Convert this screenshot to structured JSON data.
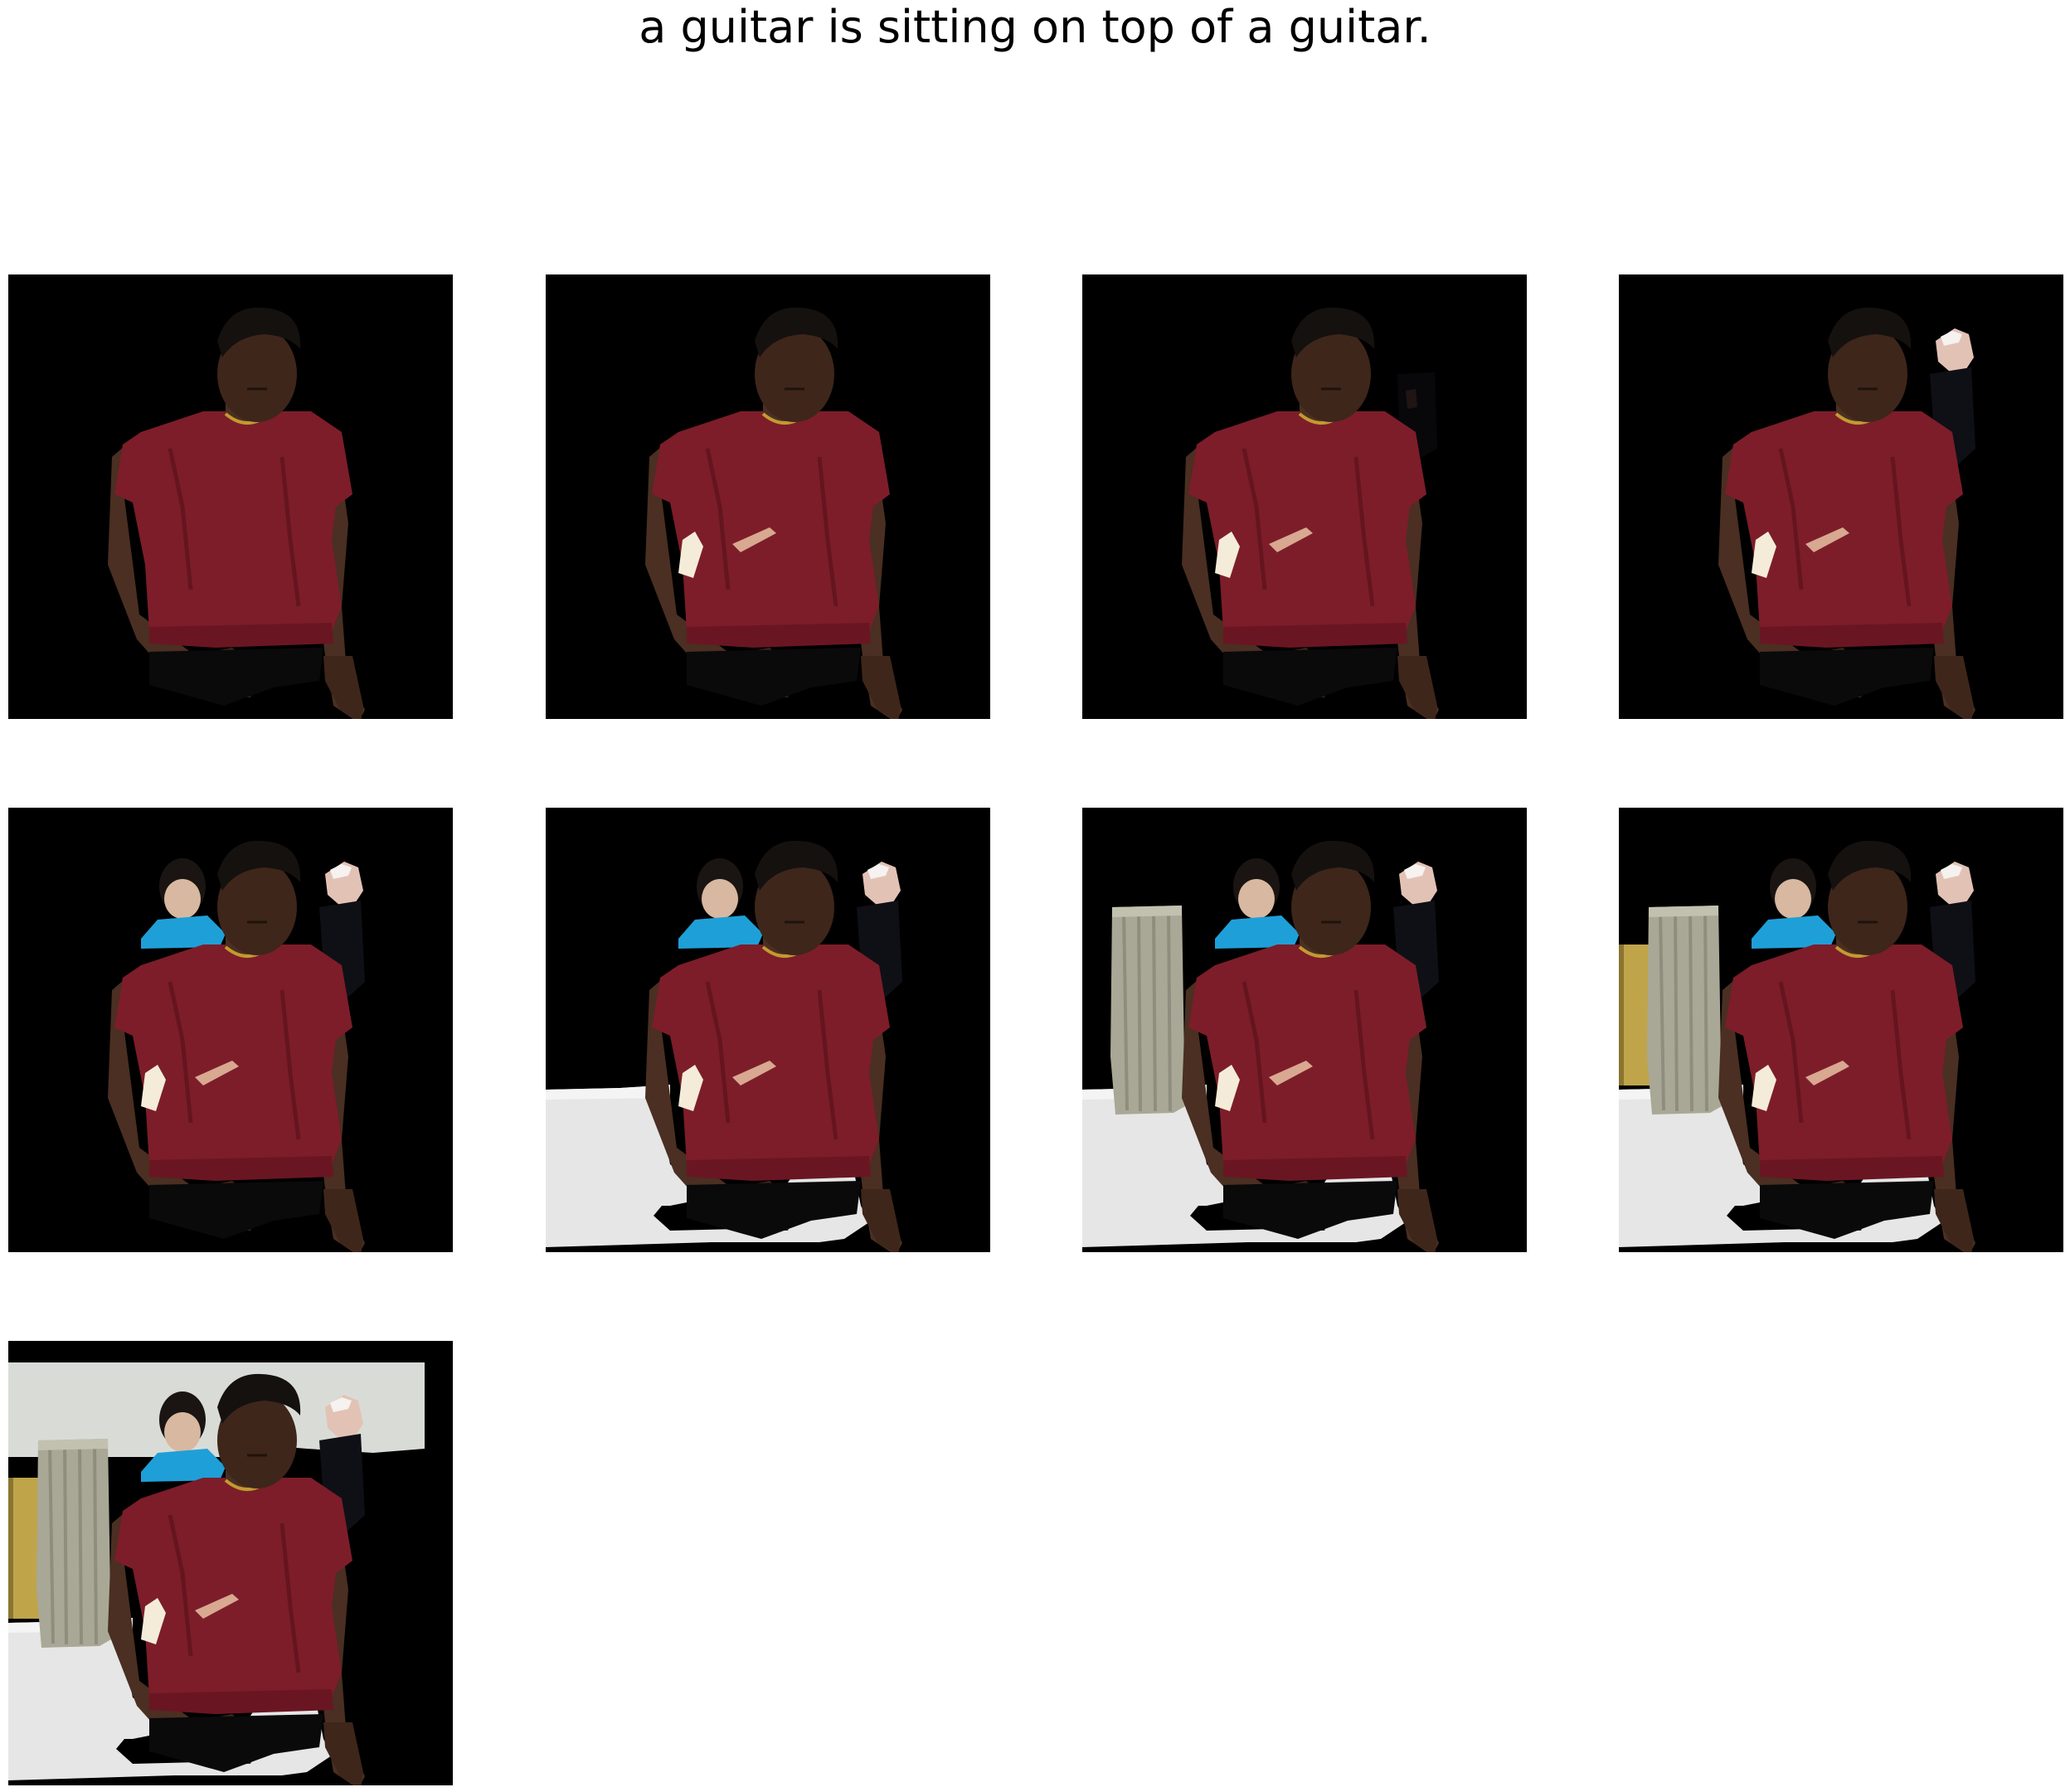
{
  "caption": "a guitar is sitting on top of a guitar.",
  "panels": [
    {
      "index": 1,
      "layers": [
        "person"
      ]
    },
    {
      "index": 2,
      "layers": [
        "person",
        "hand-object"
      ]
    },
    {
      "index": 3,
      "layers": [
        "person",
        "hand-object",
        "dark-object"
      ]
    },
    {
      "index": 4,
      "layers": [
        "person",
        "hand-object",
        "dark-object",
        "background-head"
      ]
    },
    {
      "index": 5,
      "layers": [
        "person",
        "hand-object",
        "dark-object",
        "background-head",
        "blue-shirt-person"
      ]
    },
    {
      "index": 6,
      "layers": [
        "person",
        "hand-object",
        "dark-object",
        "background-head",
        "blue-shirt-person",
        "white-table"
      ]
    },
    {
      "index": 7,
      "layers": [
        "person",
        "hand-object",
        "dark-object",
        "background-head",
        "blue-shirt-person",
        "white-table",
        "curtain"
      ]
    },
    {
      "index": 8,
      "layers": [
        "person",
        "hand-object",
        "dark-object",
        "background-head",
        "blue-shirt-person",
        "white-table",
        "curtain",
        "yellow-wall"
      ]
    },
    {
      "index": 9,
      "layers": [
        "person",
        "hand-object",
        "dark-object",
        "background-head",
        "blue-shirt-person",
        "white-table",
        "curtain",
        "yellow-wall",
        "back-wall"
      ]
    }
  ],
  "colors": {
    "panel_background": "#000000",
    "shirt": "#7d1d2a",
    "skin": "#4a2f22",
    "hair": "#15110f",
    "blue_shirt": "#1f9fd8",
    "table": "#e6e6e6",
    "curtain": "#a9a896",
    "yellow_wall": "#bfa44a",
    "back_wall": "#d9dcd6"
  }
}
